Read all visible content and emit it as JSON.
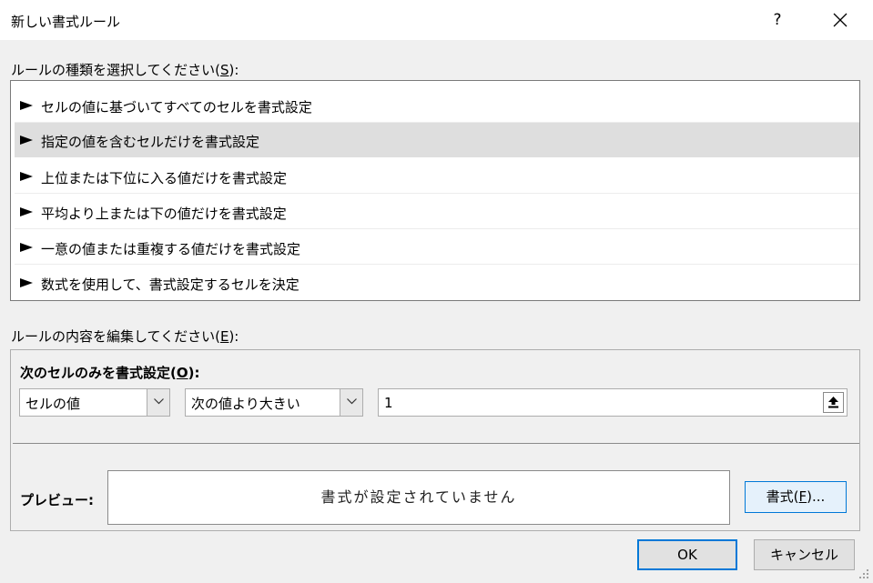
{
  "window": {
    "title": "新しい書式ルール",
    "help": "?"
  },
  "rule_type": {
    "label": "ルールの種類を選択してください(",
    "accel": "S",
    "label_end": "):",
    "items": [
      {
        "label": "セルの値に基づいてすべてのセルを書式設定",
        "selected": false
      },
      {
        "label": "指定の値を含むセルだけを書式設定",
        "selected": true
      },
      {
        "label": "上位または下位に入る値だけを書式設定",
        "selected": false
      },
      {
        "label": "平均より上または下の値だけを書式設定",
        "selected": false
      },
      {
        "label": "一意の値または重複する値だけを書式設定",
        "selected": false
      },
      {
        "label": "数式を使用して、書式設定するセルを決定",
        "selected": false
      }
    ]
  },
  "rule_edit": {
    "label": "ルールの内容を編集してください(",
    "accel": "E",
    "label_end": "):",
    "condition_label": "次のセルのみを書式設定(",
    "condition_accel": "O",
    "condition_end": "):",
    "cell_type_value": "セルの値",
    "operator_value": "次の値より大きい",
    "value": "1",
    "preview_label": "プレビュー:",
    "preview_text": "書式が設定されていません",
    "format_button": {
      "prefix": "書式(",
      "accel": "F",
      "suffix": ")..."
    }
  },
  "buttons": {
    "ok": "OK",
    "cancel": "キャンセル"
  }
}
